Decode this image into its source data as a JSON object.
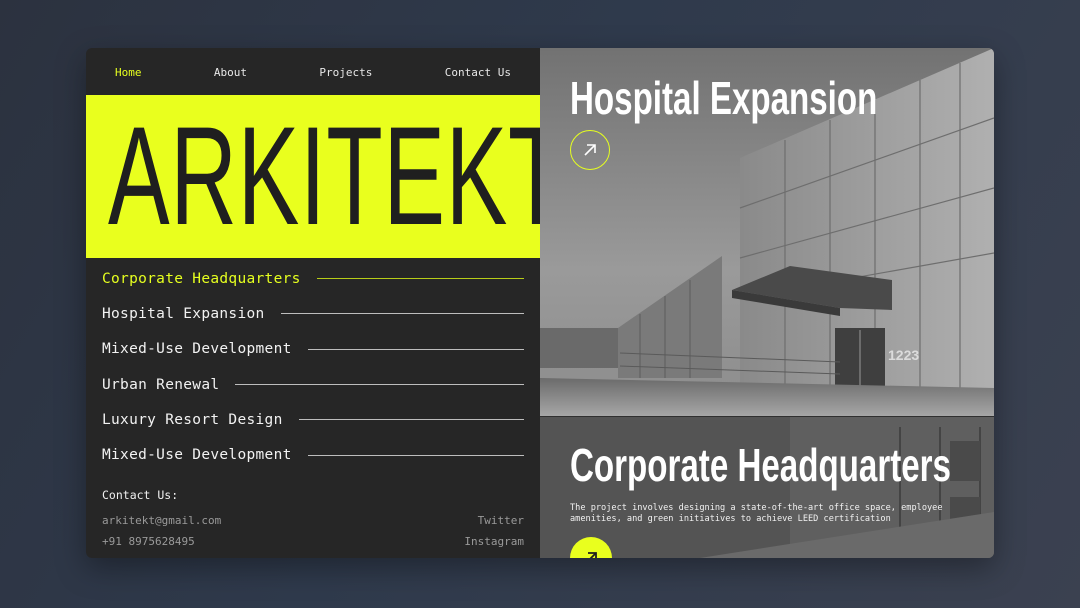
{
  "nav": {
    "items": [
      "Home",
      "About",
      "Projects",
      "Contact Us"
    ],
    "active": "Home"
  },
  "hero": {
    "title": "ARKITEKT"
  },
  "projects": [
    {
      "label": "Corporate Headquarters",
      "active": true
    },
    {
      "label": "Hospital Expansion",
      "active": false
    },
    {
      "label": "Mixed-Use Development",
      "active": false
    },
    {
      "label": "Urban Renewal",
      "active": false
    },
    {
      "label": "Luxury Resort Design",
      "active": false
    },
    {
      "label": "Mixed-Use Development",
      "active": false
    }
  ],
  "contact": {
    "heading": "Contact Us:",
    "email": "arkitekt@gmail.com",
    "phone": "+91 8975628495",
    "social": [
      "Twitter",
      "Instagram"
    ]
  },
  "featured": [
    {
      "title": "Hospital Expansion",
      "building_number": "1223",
      "icon": "arrow-up-right-icon"
    },
    {
      "title": "Corporate Headquarters",
      "description": "The project involves designing a state-of-the-art office space, employee amenities, and green initiatives to achieve LEED certification",
      "icon": "arrow-up-right-icon"
    }
  ],
  "colors": {
    "accent": "#e9ff1e",
    "panel": "#262626",
    "text": "#f2f2f2"
  }
}
